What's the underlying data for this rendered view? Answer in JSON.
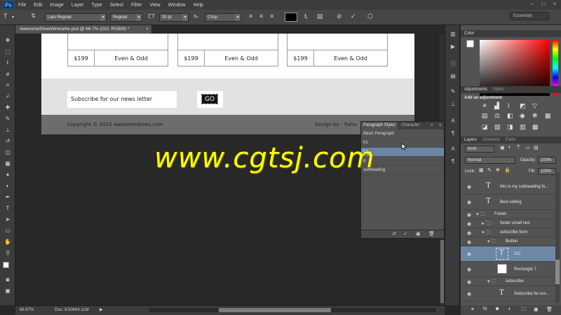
{
  "app": {
    "logo": "Ps"
  },
  "menu": [
    "File",
    "Edit",
    "Image",
    "Layer",
    "Type",
    "Select",
    "Filter",
    "View",
    "Window",
    "Help"
  ],
  "options": {
    "font_family": "Lato Regular",
    "font_style": "Regular",
    "font_size": "30 pt",
    "aa_label": "aₐ",
    "antialias": "Crisp",
    "text_color": "#000000",
    "workspace": "Essentials"
  },
  "document": {
    "tab_title": "AwesomeShoeWirerame.psd @ 66.7% (GO, RGB/8) *",
    "products": [
      {
        "price": "$199",
        "name": "Even & Odd"
      },
      {
        "price": "$199",
        "name": "Even & Odd"
      },
      {
        "price": "$199",
        "name": "Even & Odd"
      }
    ],
    "subscribe_placeholder": "Subscribe for our news letter",
    "go_label": "GO",
    "copyright": "Copyright © 2015 awesomeshoes.com",
    "design_by": "Design by - Rahu"
  },
  "paragraph_panel": {
    "tabs": [
      "Paragraph Styles",
      "Character"
    ],
    "styles": [
      "Basic Paragraph",
      "h1",
      "h2",
      "p",
      "subheading"
    ],
    "selected_index": 2
  },
  "color_panel": {
    "title": "Color",
    "foreground": "#ffffff",
    "background": "#ffffff"
  },
  "adjustments_panel": {
    "tabs": [
      "Adjustments",
      "Styles"
    ],
    "heading": "Add an adjustment"
  },
  "layers_panel": {
    "tabs": [
      "Layers",
      "Channels",
      "Paths"
    ],
    "filter_kind": "Kind",
    "blend_mode": "Normal",
    "opacity_label": "Opacity:",
    "opacity": "100%",
    "lock_label": "Lock:",
    "fill_label": "Fill:",
    "fill": "100%",
    "layers": [
      {
        "name": "this is my subheading fo...",
        "type": "text"
      },
      {
        "name": "Best selling",
        "type": "text"
      },
      {
        "name": "Footer",
        "type": "group"
      },
      {
        "name": "footer small rect",
        "type": "group"
      },
      {
        "name": "subscribe form",
        "type": "group"
      },
      {
        "name": "Button",
        "type": "group"
      },
      {
        "name": "GO",
        "type": "text",
        "selected": true
      },
      {
        "name": "Rectangle 7",
        "type": "shape"
      },
      {
        "name": "subscribe",
        "type": "group"
      },
      {
        "name": "Subscribe for our...",
        "type": "text"
      }
    ]
  },
  "status": {
    "zoom": "66.67%",
    "doc": "Doc: 9.50M/4.11M"
  },
  "watermark": "www.cgtsj.com"
}
